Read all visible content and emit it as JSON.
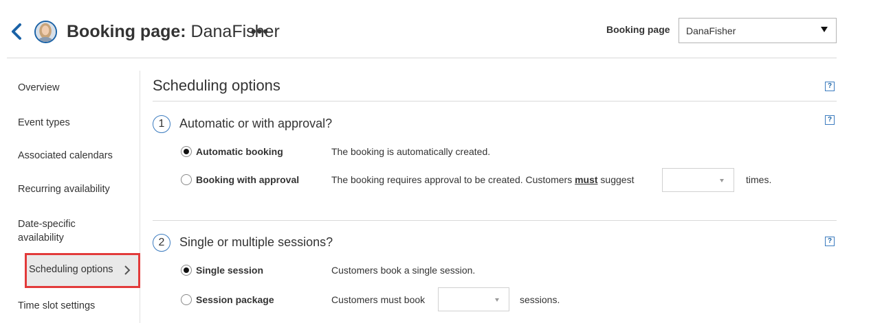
{
  "header": {
    "title_bold": "Booking page:",
    "title_name": " DanaFisher",
    "more": "•••",
    "booking_page_label": "Booking page",
    "booking_page_value": "DanaFisher"
  },
  "sidebar": {
    "items": [
      {
        "label": "Overview"
      },
      {
        "label": "Event types"
      },
      {
        "label": "Associated calendars"
      },
      {
        "label": "Recurring availability"
      },
      {
        "label": "Date-specific\navailability"
      },
      {
        "label": "Scheduling options"
      },
      {
        "label": "Time slot settings"
      }
    ],
    "active_index": 5
  },
  "main": {
    "title": "Scheduling options",
    "help": "?",
    "sections": [
      {
        "number": "1",
        "title": "Automatic or with approval?",
        "options": [
          {
            "label": "Automatic booking",
            "description": "The booking is automatically created.",
            "checked": true
          },
          {
            "label": "Booking with approval",
            "description_pre": "The booking requires approval to be created. Customers ",
            "description_emph": "must",
            "description_post": " suggest",
            "suffix": "times.",
            "checked": false
          }
        ]
      },
      {
        "number": "2",
        "title": "Single or multiple sessions?",
        "options": [
          {
            "label": "Single session",
            "description": "Customers book a single session.",
            "checked": true
          },
          {
            "label": "Session package",
            "description": "Customers must book",
            "suffix": "sessions.",
            "checked": false
          }
        ]
      }
    ]
  },
  "colors": {
    "accent": "#1a62a6",
    "highlight_border": "#e23a3a",
    "active_bg": "#e9e9e9"
  }
}
